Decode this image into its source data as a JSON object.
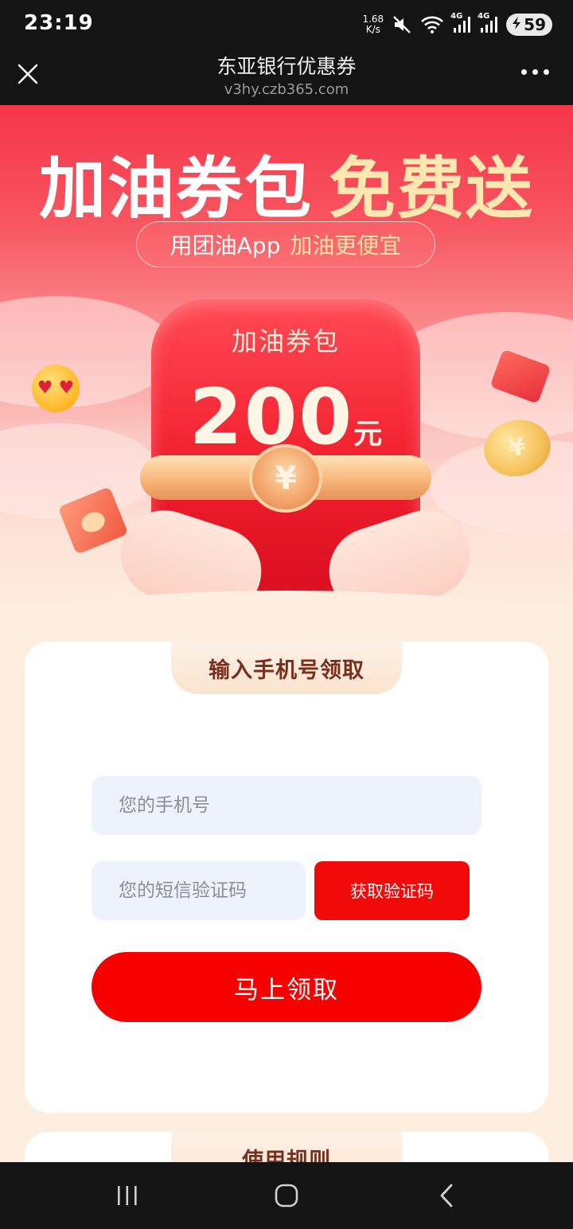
{
  "status_bar": {
    "time": "23:19",
    "net_speed_value": "1.68",
    "net_speed_unit": "K/s",
    "signal_1_label": "4G",
    "signal_2_label": "4G",
    "battery": "59",
    "icons": [
      "mute-icon",
      "wifi-icon",
      "signal-icon",
      "signal-icon",
      "battery-icon"
    ]
  },
  "browser": {
    "title": "东亚银行优惠券",
    "url": "v3hy.czb365.com",
    "icons": [
      "close-icon",
      "more-icon"
    ]
  },
  "hero": {
    "headline_white": "加油券包",
    "headline_gold": "免费送",
    "subtitle_a": "用团油App",
    "subtitle_b": "加油更便宜",
    "bag_label": "加油券包",
    "amount": "200",
    "unit": "元",
    "coin_symbol": "¥"
  },
  "form": {
    "card_title": "输入手机号领取",
    "phone_placeholder": "您的手机号",
    "code_placeholder": "您的短信验证码",
    "get_code_label": "获取验证码",
    "submit_label": "马上领取"
  },
  "rules": {
    "title": "使用规则"
  },
  "nav": {
    "icons": [
      "recent-apps-icon",
      "home-icon",
      "back-icon"
    ]
  },
  "colors": {
    "brand_red": "#f60000",
    "hero_red": "#f5364a",
    "gold": "#ffe7b0",
    "input_bg": "#eef2fd",
    "page_bg": "#fdeee0"
  }
}
